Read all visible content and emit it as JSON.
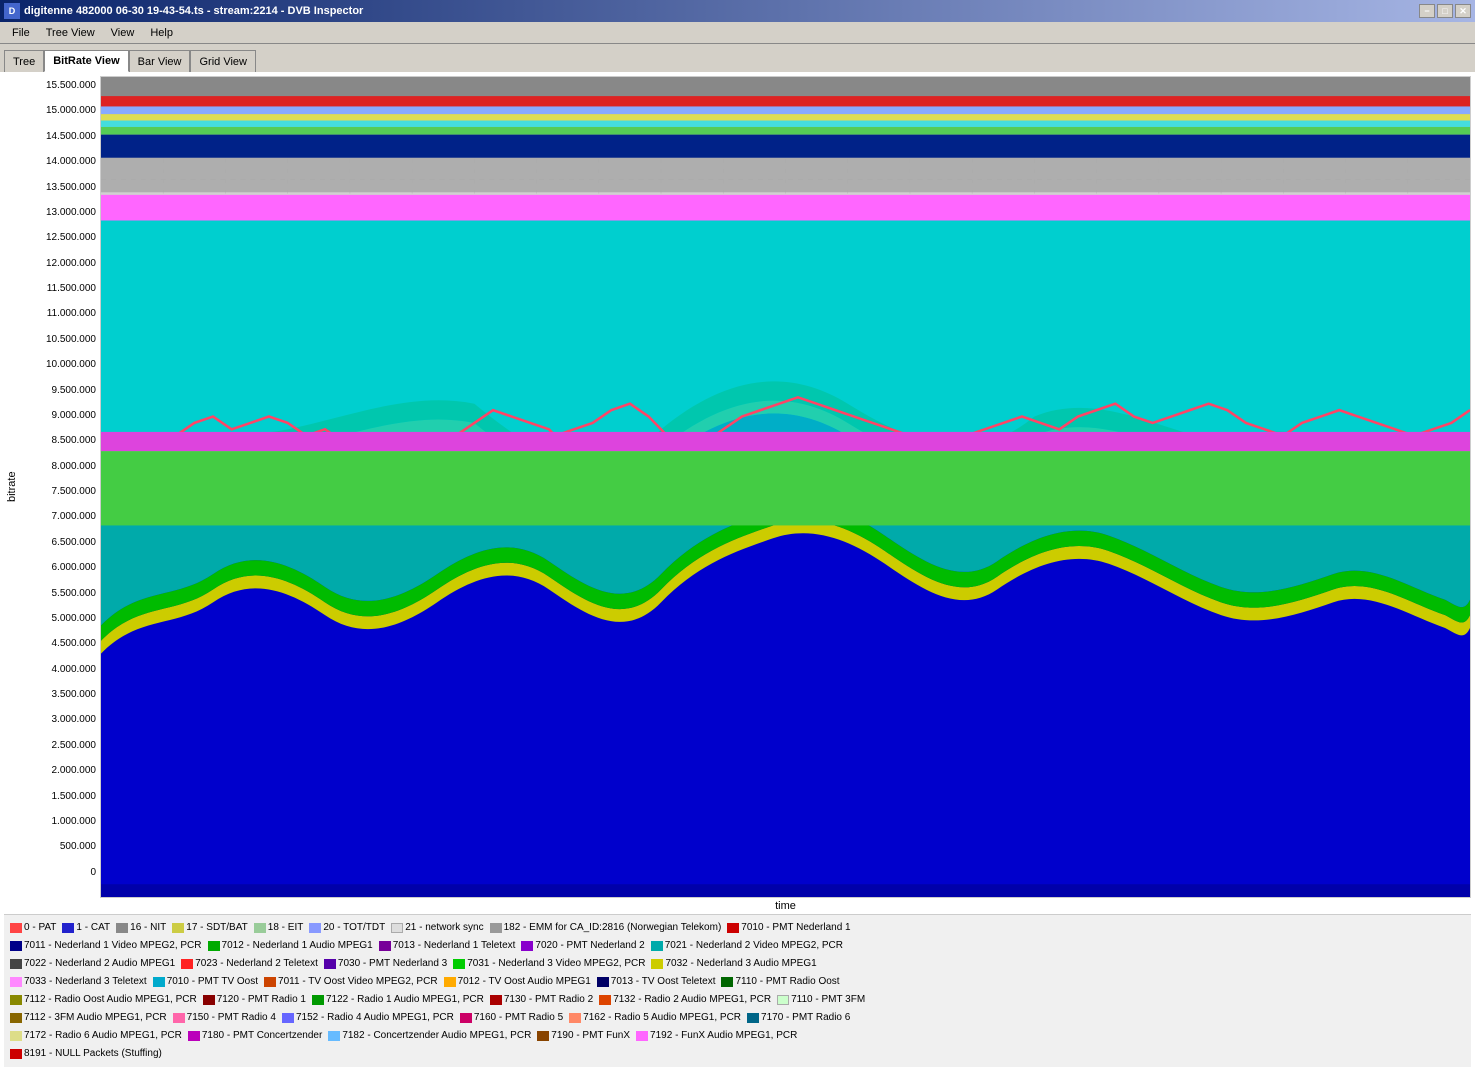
{
  "titlebar": {
    "icon": "dvb-icon",
    "title": "digitenne 482000 06-30 19-43-54.ts - stream:2214 - DVB Inspector",
    "minimize": "−",
    "maximize": "□",
    "close": "✕"
  },
  "menubar": {
    "items": [
      {
        "id": "file",
        "label": "File"
      },
      {
        "id": "treeview",
        "label": "Tree View"
      },
      {
        "id": "view",
        "label": "View"
      },
      {
        "id": "help",
        "label": "Help"
      }
    ]
  },
  "toolbar": {
    "tabs": [
      {
        "id": "tree",
        "label": "Tree",
        "active": false
      },
      {
        "id": "bitrate",
        "label": "BitRate View",
        "active": true
      },
      {
        "id": "bar",
        "label": "Bar View",
        "active": false
      },
      {
        "id": "grid",
        "label": "Grid View",
        "active": false
      }
    ]
  },
  "chart": {
    "yaxis": {
      "label": "bitrate",
      "ticks": [
        "15.500.000",
        "15.000.000",
        "14.500.000",
        "14.000.000",
        "13.500.000",
        "13.000.000",
        "12.500.000",
        "12.000.000",
        "11.500.000",
        "11.000.000",
        "10.500.000",
        "10.000.000",
        "9.500.000",
        "9.000.000",
        "8.500.000",
        "8.000.000",
        "7.500.000",
        "7.000.000",
        "6.500.000",
        "6.000.000",
        "5.500.000",
        "5.000.000",
        "4.500.000",
        "4.000.000",
        "3.500.000",
        "3.000.000",
        "2.500.000",
        "2.000.000",
        "1.500.000",
        "1.000.000",
        "500.000",
        "0"
      ]
    },
    "xaxis": {
      "label": "time"
    }
  },
  "legend": {
    "rows": [
      [
        {
          "color": "#ff4444",
          "label": "0 - PAT"
        },
        {
          "color": "#4444ff",
          "label": "1 - CAT"
        },
        {
          "color": "#888888",
          "label": "16 - NIT"
        },
        {
          "color": "#ffff88",
          "label": "17 - SDT/BAT"
        },
        {
          "color": "#aaffaa",
          "label": "18 - EIT"
        },
        {
          "color": "#88aaff",
          "label": "20 - TOT/TDT"
        },
        {
          "color": "#dddddd",
          "label": "21 - network sync"
        },
        {
          "color": "#888888",
          "label": "182 - EMM for CA_ID:2816 (Norwegian Telekom)"
        },
        {
          "color": "#cc0000",
          "label": "7010 - PMT Nederland 1"
        }
      ],
      [
        {
          "color": "#000088",
          "label": "7011 - Nederland 1 Video MPEG2, PCR"
        },
        {
          "color": "#00aa00",
          "label": "7012 - Nederland 1 Audio MPEG1"
        },
        {
          "color": "#7700aa",
          "label": "7013 - Nederland 1 Teletext"
        },
        {
          "color": "#8800cc",
          "label": "7020 - PMT Nederland 2"
        },
        {
          "color": "#00aaaa",
          "label": "7021 - Nederland 2 Video MPEG2, PCR"
        }
      ],
      [
        {
          "color": "#444444",
          "label": "7022 - Nederland 2 Audio MPEG1"
        },
        {
          "color": "#ff2222",
          "label": "7023 - Nederland 2 Teletext"
        },
        {
          "color": "#5500aa",
          "label": "7030 - PMT Nederland 3"
        },
        {
          "color": "#00cc00",
          "label": "7031 - Nederland 3 Video MPEG2, PCR"
        },
        {
          "color": "#dddd00",
          "label": "7032 - Nederland 3 Audio MPEG1"
        }
      ],
      [
        {
          "color": "#ff88ff",
          "label": "7033 - Nederland 3 Teletext"
        },
        {
          "color": "#00aacc",
          "label": "7010 - PMT TV Oost"
        },
        {
          "color": "#cc4400",
          "label": "7011 - TV Oost Video MPEG2, PCR"
        },
        {
          "color": "#ffaa00",
          "label": "7012 - TV Oost Audio MPEG1"
        },
        {
          "color": "#000066",
          "label": "7013 - TV Oost Teletext"
        },
        {
          "color": "#006600",
          "label": "7110 - PMT Radio Oost"
        }
      ],
      [
        {
          "color": "#888800",
          "label": "7112 - Radio Oost Audio MPEG1, PCR"
        },
        {
          "color": "#880000",
          "label": "7120 - PMT Radio 1"
        },
        {
          "color": "#009900",
          "label": "7122 - Radio 1 Audio MPEG1, PCR"
        },
        {
          "color": "#aa0000",
          "label": "7130 - PMT Radio 2"
        },
        {
          "color": "#dd4400",
          "label": "7132 - Radio 2 Audio MPEG1, PCR"
        },
        {
          "color": "#ccffcc",
          "label": "7110 - PMT 3FM"
        }
      ],
      [
        {
          "color": "#886600",
          "label": "7112 - 3FM Audio MPEG1, PCR"
        },
        {
          "color": "#ff66aa",
          "label": "7150 - PMT Radio 4"
        },
        {
          "color": "#6666ff",
          "label": "7152 - Radio 4 Audio MPEG1, PCR"
        },
        {
          "color": "#cc0066",
          "label": "7160 - PMT Radio 5"
        },
        {
          "color": "#ff8866",
          "label": "7162 - Radio 5 Audio MPEG1, PCR"
        },
        {
          "color": "#006688",
          "label": "7170 - PMT Radio 6"
        }
      ],
      [
        {
          "color": "#dddd88",
          "label": "7172 - Radio 6 Audio MPEG1, PCR"
        },
        {
          "color": "#bb00bb",
          "label": "7180 - PMT Concertzender"
        },
        {
          "color": "#66bbff",
          "label": "7182 - Concertzender Audio MPEG1, PCR"
        },
        {
          "color": "#884400",
          "label": "7190 - PMT FunX"
        },
        {
          "color": "#ff66ff",
          "label": "7192 - FunX Audio MPEG1, PCR"
        }
      ],
      [
        {
          "color": "#cc0000",
          "label": "8191 - NULL Packets (Stuffing)"
        }
      ]
    ]
  }
}
